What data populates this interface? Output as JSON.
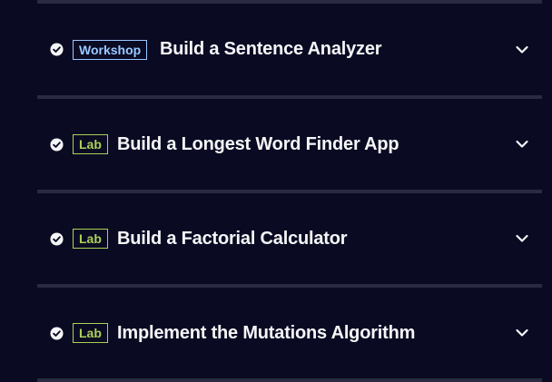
{
  "steps": [
    {
      "badge": "Workshop",
      "title": "Build a Sentence Analyzer",
      "completed": true
    },
    {
      "badge": "Lab",
      "title": "Build a Longest Word Finder App",
      "completed": true
    },
    {
      "badge": "Lab",
      "title": "Build a Factorial Calculator",
      "completed": true
    },
    {
      "badge": "Lab",
      "title": "Implement the Mutations Algorithm",
      "completed": true
    }
  ],
  "icons": {
    "status": "check-circle-icon",
    "expand": "chevron-down-icon"
  },
  "colors": {
    "background": "#0a0a23",
    "divider": "#2a2a40",
    "workshop_badge": "#99c9ff",
    "lab_badge": "#acd157",
    "text": "#f5f6f7"
  }
}
